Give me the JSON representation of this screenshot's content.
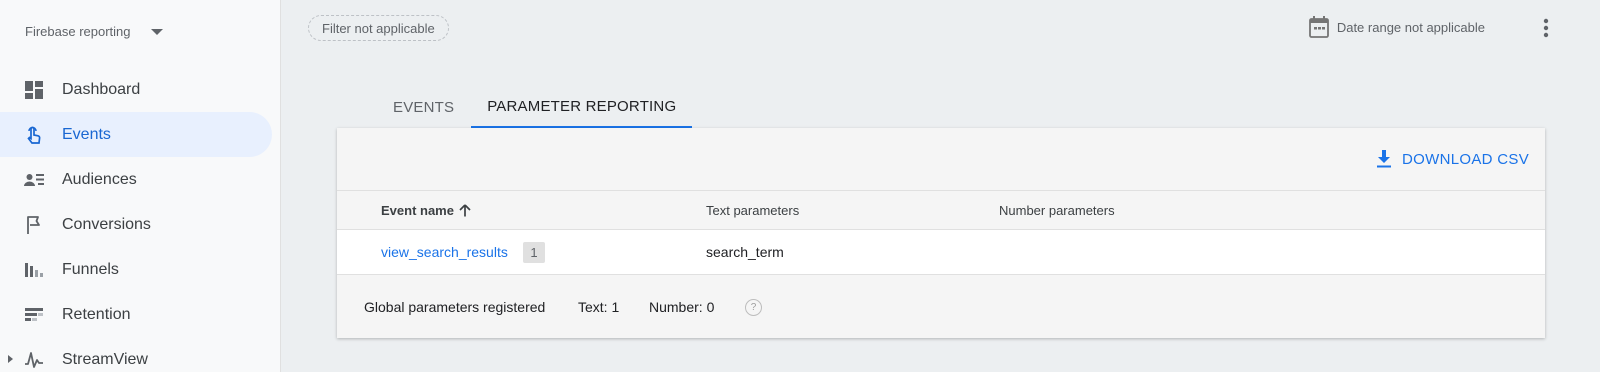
{
  "sidebar": {
    "project": "Firebase reporting",
    "items": [
      {
        "label": "Dashboard",
        "icon": "dashboard-icon",
        "active": false
      },
      {
        "label": "Events",
        "icon": "touch-icon",
        "active": true
      },
      {
        "label": "Audiences",
        "icon": "audience-icon",
        "active": false
      },
      {
        "label": "Conversions",
        "icon": "flag-icon",
        "active": false
      },
      {
        "label": "Funnels",
        "icon": "funnel-icon",
        "active": false
      },
      {
        "label": "Retention",
        "icon": "retention-icon",
        "active": false
      },
      {
        "label": "StreamView",
        "icon": "streamview-icon",
        "active": false
      }
    ]
  },
  "topbar": {
    "filter_label": "Filter not applicable",
    "date_range_label": "Date range not applicable"
  },
  "tabs": [
    {
      "label": "EVENTS",
      "active": false
    },
    {
      "label": "PARAMETER REPORTING",
      "active": true
    }
  ],
  "card": {
    "download_label": "DOWNLOAD CSV",
    "columns": {
      "event_name": "Event name",
      "text_params": "Text parameters",
      "number_params": "Number parameters"
    },
    "rows": [
      {
        "event_name": "view_search_results",
        "count": "1",
        "text_params": "search_term",
        "number_params": ""
      }
    ],
    "footer": {
      "global_label": "Global parameters registered",
      "text_count": "Text: 1",
      "number_count": "Number: 0",
      "help": "?"
    }
  },
  "colors": {
    "accent": "#1a73e8",
    "active_nav_bg": "#e8f0fe",
    "page_bg": "#eceff1"
  }
}
